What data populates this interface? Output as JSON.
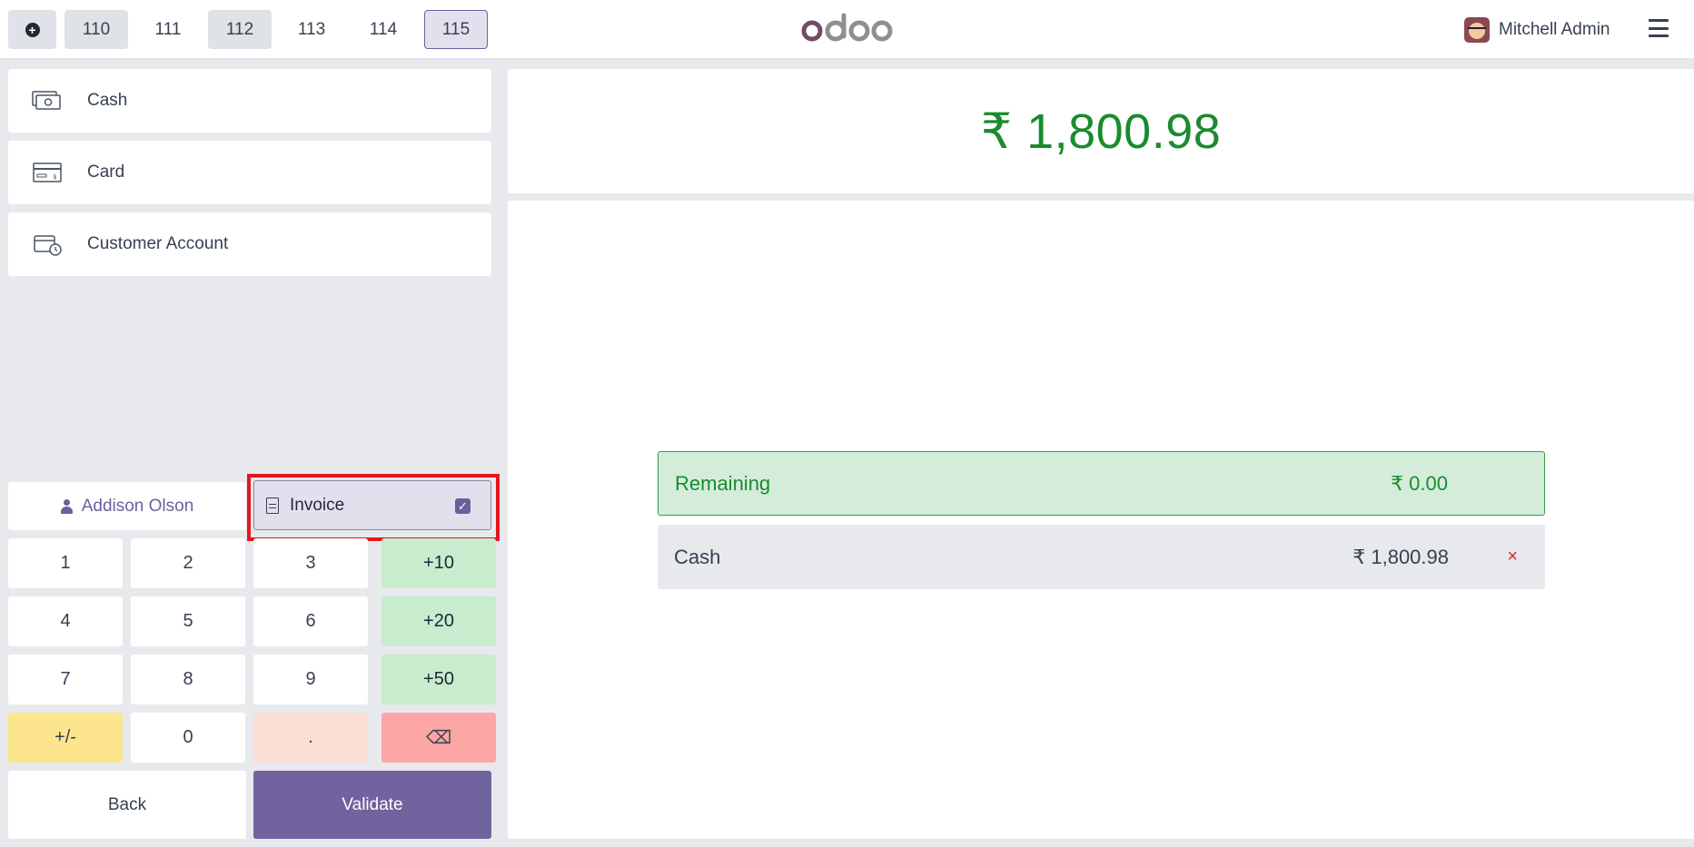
{
  "header": {
    "new_order_icon": "plus-circle-icon",
    "order_tabs": [
      {
        "label": "110",
        "style": "grey"
      },
      {
        "label": "111",
        "style": "plain"
      },
      {
        "label": "112",
        "style": "grey"
      },
      {
        "label": "113",
        "style": "plain"
      },
      {
        "label": "114",
        "style": "plain"
      },
      {
        "label": "115",
        "style": "active"
      }
    ],
    "logo": "odoo",
    "user_name": "Mitchell Admin",
    "menu_icon": "hamburger-menu-icon"
  },
  "payment_methods": [
    {
      "label": "Cash",
      "icon": "cash-icon"
    },
    {
      "label": "Card",
      "icon": "card-icon"
    },
    {
      "label": "Customer Account",
      "icon": "customer-account-icon"
    }
  ],
  "customer": {
    "name": "Addison Olson",
    "icon": "user-icon"
  },
  "invoice": {
    "label": "Invoice",
    "checked": true,
    "highlight_color": "#e8161b"
  },
  "numpad": {
    "keys": [
      "1",
      "2",
      "3",
      "+10",
      "4",
      "5",
      "6",
      "+20",
      "7",
      "8",
      "9",
      "+50",
      "+/-",
      "0",
      ".",
      "⌫"
    ]
  },
  "actions": {
    "back_label": "Back",
    "validate_label": "Validate"
  },
  "summary": {
    "total": "₹ 1,800.98",
    "remaining_label": "Remaining",
    "remaining_value": "₹ 0.00",
    "lines": [
      {
        "method": "Cash",
        "amount": "₹ 1,800.98",
        "delete_glyph": "×"
      }
    ]
  },
  "colors": {
    "accent": "#71639e",
    "success": "#1a8b2e",
    "danger": "#dc2626"
  }
}
